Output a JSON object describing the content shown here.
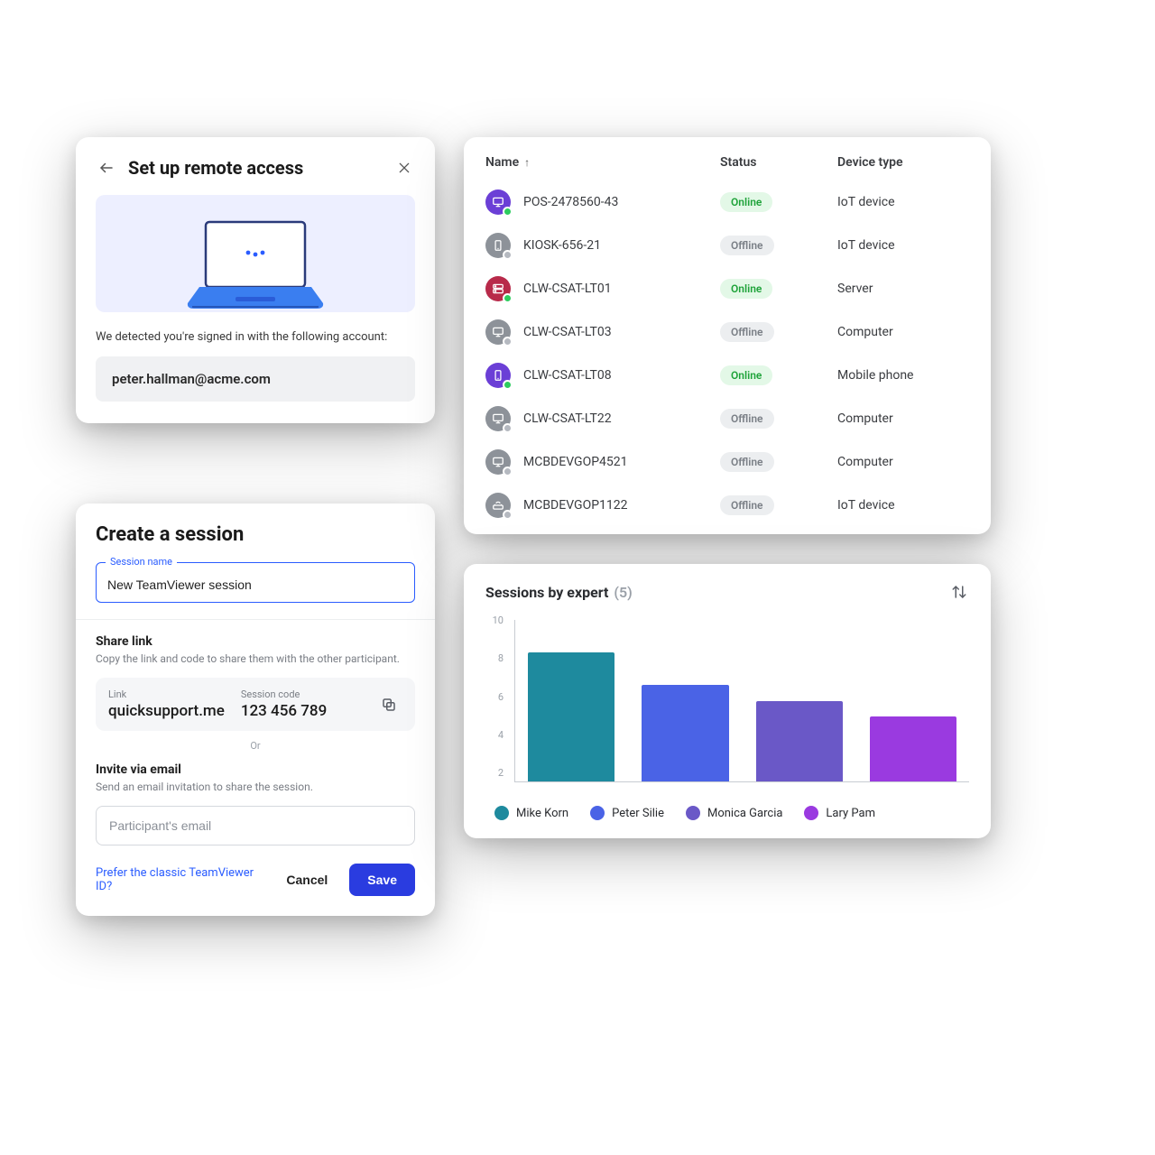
{
  "setup": {
    "title": "Set up remote access",
    "detected": "We detected you're signed in with the following account:",
    "account": "peter.hallman@acme.com"
  },
  "session": {
    "title": "Create a session",
    "name_label": "Session name",
    "name_value": "New TeamViewer session",
    "share_h": "Share link",
    "share_d": "Copy the link and code to share them with the other participant.",
    "link_label": "Link",
    "link_value": "quicksupport.me",
    "code_label": "Session code",
    "code_value": "123 456 789",
    "or": "Or",
    "email_h": "Invite via email",
    "email_d": "Send an email invitation to share the session.",
    "email_placeholder": "Participant's email",
    "classic": "Prefer the classic TeamViewer ID?",
    "cancel": "Cancel",
    "save": "Save"
  },
  "table": {
    "h_name": "Name",
    "h_status": "Status",
    "h_type": "Device type",
    "rows": [
      {
        "name": "POS-2478560-43",
        "status": "Online",
        "type": "IoT device",
        "color": "bg-purple",
        "icon": "monitor"
      },
      {
        "name": "KIOSK-656-21",
        "status": "Offline",
        "type": "IoT device",
        "color": "bg-grey",
        "icon": "phone"
      },
      {
        "name": "CLW-CSAT-LT01",
        "status": "Online",
        "type": "Server",
        "color": "bg-red",
        "icon": "server"
      },
      {
        "name": "CLW-CSAT-LT03",
        "status": "Offline",
        "type": "Computer",
        "color": "bg-grey",
        "icon": "monitor"
      },
      {
        "name": "CLW-CSAT-LT08",
        "status": "Online",
        "type": "Mobile phone",
        "color": "bg-purple",
        "icon": "phone"
      },
      {
        "name": "CLW-CSAT-LT22",
        "status": "Offline",
        "type": "Computer",
        "color": "bg-grey",
        "icon": "monitor"
      },
      {
        "name": "MCBDEVGOP4521",
        "status": "Offline",
        "type": "Computer",
        "color": "bg-grey",
        "icon": "monitor"
      },
      {
        "name": "MCBDEVGOP1122",
        "status": "Offline",
        "type": "IoT device",
        "color": "bg-grey",
        "icon": "router"
      }
    ]
  },
  "chart": {
    "title": "Sessions by expert",
    "count": "(5)"
  },
  "chart_data": {
    "type": "bar",
    "title": "Sessions by expert (5)",
    "xlabel": "",
    "ylabel": "",
    "ylim": [
      0,
      10
    ],
    "yticks": [
      10,
      8,
      6,
      4,
      2
    ],
    "categories": [
      "Mike Korn",
      "Peter Silie",
      "Monica Garcia",
      "Lary Pam"
    ],
    "values": [
      8,
      6,
      5,
      4
    ],
    "colors": [
      "#1e8a9e",
      "#4a63e6",
      "#6a58c7",
      "#9a3ae0"
    ]
  }
}
